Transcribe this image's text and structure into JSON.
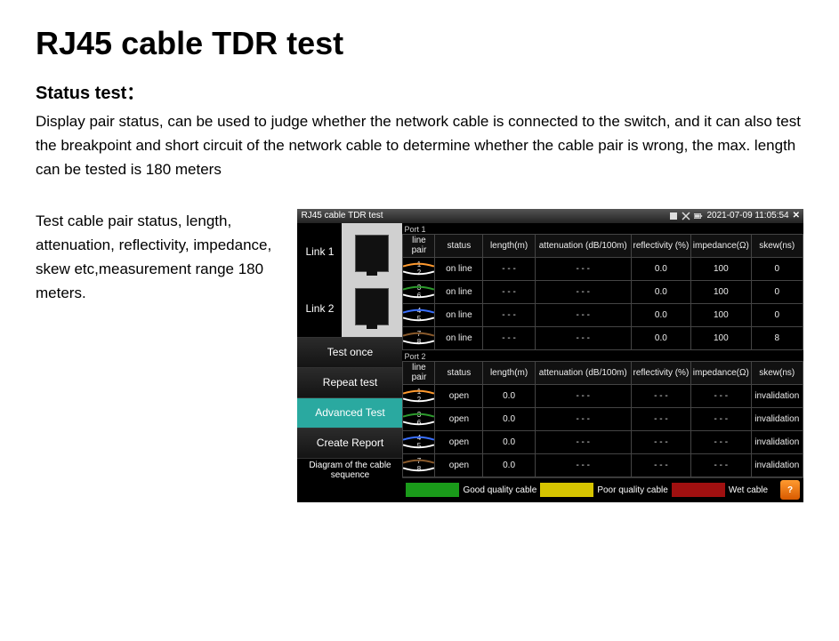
{
  "page": {
    "title": "RJ45 cable TDR test",
    "subtitle": "Status test：",
    "description": "Display pair status, can be used to judge whether the network cable is connected to the switch, and it can also test the breakpoint and short circuit of the network cable to determine whether the cable pair is wrong, the max. length can be tested is 180 meters",
    "side_note": "Test cable pair status, length, attenuation, reflectivity, impedance, skew etc,measurement range 180 meters."
  },
  "device": {
    "title": "RJ45 cable TDR test",
    "datetime": "2021-07-09 11:05:54",
    "links": {
      "link1": "Link 1",
      "link2": "Link 2"
    },
    "buttons": {
      "test_once": "Test once",
      "repeat_test": "Repeat test",
      "advanced_test": "Advanced Test",
      "create_report": "Create Report"
    },
    "footer_label": "Diagram of the cable sequence",
    "port1_label": "Port 1",
    "port2_label": "Port 2",
    "headers": {
      "line_pair": "line pair",
      "status": "status",
      "length": "length(m)",
      "attenuation": "attenuation (dB/100m)",
      "reflectivity": "reflectivity (%)",
      "impedance": "impedance(Ω)",
      "skew": "skew(ns)"
    },
    "port1_rows": [
      {
        "pair_a": "1",
        "pair_b": "2",
        "status": "on line",
        "length": "- - -",
        "attenuation": "- - -",
        "reflectivity": "0.0",
        "impedance": "100",
        "skew": "0"
      },
      {
        "pair_a": "3",
        "pair_b": "6",
        "status": "on line",
        "length": "- - -",
        "attenuation": "- - -",
        "reflectivity": "0.0",
        "impedance": "100",
        "skew": "0"
      },
      {
        "pair_a": "4",
        "pair_b": "5",
        "status": "on line",
        "length": "- - -",
        "attenuation": "- - -",
        "reflectivity": "0.0",
        "impedance": "100",
        "skew": "0"
      },
      {
        "pair_a": "7",
        "pair_b": "8",
        "status": "on line",
        "length": "- - -",
        "attenuation": "- - -",
        "reflectivity": "0.0",
        "impedance": "100",
        "skew": "8"
      }
    ],
    "port2_rows": [
      {
        "pair_a": "1",
        "pair_b": "2",
        "status": "open",
        "length": "0.0",
        "attenuation": "- - -",
        "reflectivity": "- - -",
        "impedance": "- - -",
        "skew": "invalidation"
      },
      {
        "pair_a": "3",
        "pair_b": "6",
        "status": "open",
        "length": "0.0",
        "attenuation": "- - -",
        "reflectivity": "- - -",
        "impedance": "- - -",
        "skew": "invalidation"
      },
      {
        "pair_a": "4",
        "pair_b": "5",
        "status": "open",
        "length": "0.0",
        "attenuation": "- - -",
        "reflectivity": "- - -",
        "impedance": "- - -",
        "skew": "invalidation"
      },
      {
        "pair_a": "7",
        "pair_b": "8",
        "status": "open",
        "length": "0.0",
        "attenuation": "- - -",
        "reflectivity": "- - -",
        "impedance": "- - -",
        "skew": "invalidation"
      }
    ],
    "legend": {
      "good": "Good quality cable",
      "poor": "Poor quality cable",
      "wet": "Wet cable"
    }
  }
}
